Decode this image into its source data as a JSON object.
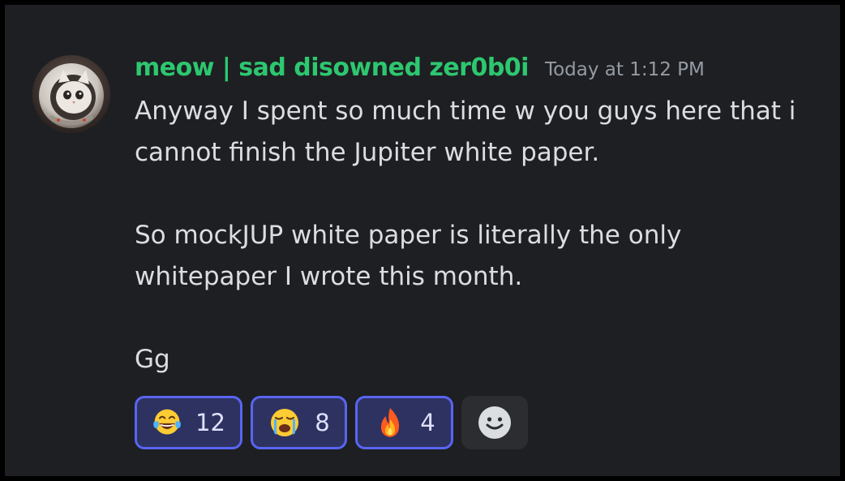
{
  "message": {
    "author": "meow | sad disowned zer0b0i",
    "timestamp": "Today at 1:12 PM",
    "lines": [
      "Anyway I spent so much time w you guys here that i",
      "cannot finish the Jupiter white paper.",
      "",
      "So mockJUP white paper is literally the only",
      "whitepaper I wrote this month.",
      "",
      "Gg"
    ]
  },
  "reactions": [
    {
      "emoji": "face-with-tears-of-joy-icon",
      "count": "12"
    },
    {
      "emoji": "loudly-crying-face-icon",
      "count": "8"
    },
    {
      "emoji": "fire-icon",
      "count": "4"
    }
  ],
  "add_reaction": {
    "icon": "smiley-face-icon"
  },
  "colors": {
    "background": "#1e1f22",
    "username": "#2dc770",
    "timestamp": "#949ba4",
    "text": "#dbdee1",
    "reaction_border": "#5865f2",
    "reaction_bg": "#2e3261"
  }
}
